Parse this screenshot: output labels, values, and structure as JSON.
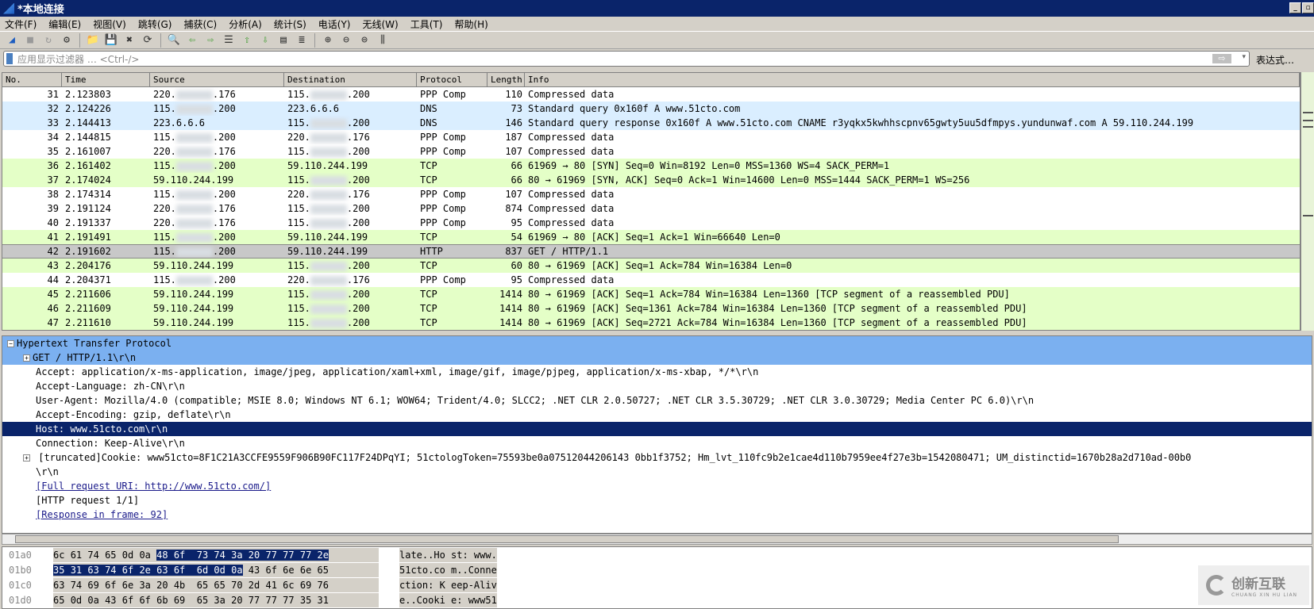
{
  "window": {
    "title": "*本地连接",
    "minimize": "_",
    "restore": "▫"
  },
  "menu": [
    "文件(F)",
    "编辑(E)",
    "视图(V)",
    "跳转(G)",
    "捕获(C)",
    "分析(A)",
    "统计(S)",
    "电话(Y)",
    "无线(W)",
    "工具(T)",
    "帮助(H)"
  ],
  "toolbar_icons": [
    "start-capture",
    "stop-capture",
    "restart-capture",
    "capture-options",
    "|",
    "open-file",
    "save-file",
    "close-file",
    "reload-file",
    "|",
    "find-packet",
    "go-back",
    "go-forward",
    "go-to-packet",
    "go-first",
    "go-last",
    "auto-scroll",
    "colorize",
    "|",
    "zoom-in",
    "zoom-out",
    "zoom-normal",
    "resize-columns"
  ],
  "filter": {
    "placeholder": "应用显示过滤器 … <Ctrl-/>",
    "expression_label": "表达式…",
    "apply": "⇨",
    "dropdown": "▾"
  },
  "columns": [
    "No.",
    "Time",
    "Source",
    "Destination",
    "Protocol",
    "Length",
    "Info"
  ],
  "colors": {
    "dns": "#daeeff",
    "tcp": "#e4ffc7",
    "ppp": "#ffffff",
    "selected": "#c8c8c8"
  },
  "packets": [
    {
      "no": "31",
      "time": "2.123803",
      "src": [
        "220.",
        ".176"
      ],
      "dst": [
        "115.",
        ".200"
      ],
      "proto": "PPP Comp",
      "len": "110",
      "info": "Compressed data",
      "kind": "ppp"
    },
    {
      "no": "32",
      "time": "2.124226",
      "src": [
        "115.",
        ".200"
      ],
      "dst": [
        "223.6.6.6",
        ""
      ],
      "proto": "DNS",
      "len": "73",
      "info": "Standard query 0x160f A www.51cto.com",
      "kind": "dns"
    },
    {
      "no": "33",
      "time": "2.144413",
      "src": [
        "223.6.6.6",
        ""
      ],
      "dst": [
        "115.",
        ".200"
      ],
      "proto": "DNS",
      "len": "146",
      "info": "Standard query response 0x160f A www.51cto.com CNAME r3yqkx5kwhhscpnv65gwty5uu5dfmpys.yundunwaf.com A 59.110.244.199",
      "kind": "dns"
    },
    {
      "no": "34",
      "time": "2.144815",
      "src": [
        "115.",
        ".200"
      ],
      "dst": [
        "220.",
        ".176"
      ],
      "proto": "PPP Comp",
      "len": "187",
      "info": "Compressed data",
      "kind": "ppp"
    },
    {
      "no": "35",
      "time": "2.161007",
      "src": [
        "220.",
        ".176"
      ],
      "dst": [
        "115.",
        ".200"
      ],
      "proto": "PPP Comp",
      "len": "107",
      "info": "Compressed data",
      "kind": "ppp"
    },
    {
      "no": "36",
      "time": "2.161402",
      "src": [
        "115.",
        ".200"
      ],
      "dst": [
        "59.110.244.199",
        ""
      ],
      "proto": "TCP",
      "len": "66",
      "info": "61969 → 80 [SYN] Seq=0 Win=8192 Len=0 MSS=1360 WS=4 SACK_PERM=1",
      "kind": "tcp"
    },
    {
      "no": "37",
      "time": "2.174024",
      "src": [
        "59.110.244.199",
        ""
      ],
      "dst": [
        "115.",
        ".200"
      ],
      "proto": "TCP",
      "len": "66",
      "info": "80 → 61969 [SYN, ACK] Seq=0 Ack=1 Win=14600 Len=0 MSS=1444 SACK_PERM=1 WS=256",
      "kind": "tcp"
    },
    {
      "no": "38",
      "time": "2.174314",
      "src": [
        "115.",
        ".200"
      ],
      "dst": [
        "220.",
        ".176"
      ],
      "proto": "PPP Comp",
      "len": "107",
      "info": "Compressed data",
      "kind": "ppp"
    },
    {
      "no": "39",
      "time": "2.191124",
      "src": [
        "220.",
        ".176"
      ],
      "dst": [
        "115.",
        ".200"
      ],
      "proto": "PPP Comp",
      "len": "874",
      "info": "Compressed data",
      "kind": "ppp"
    },
    {
      "no": "40",
      "time": "2.191337",
      "src": [
        "220.",
        ".176"
      ],
      "dst": [
        "115.",
        ".200"
      ],
      "proto": "PPP Comp",
      "len": "95",
      "info": "Compressed data",
      "kind": "ppp"
    },
    {
      "no": "41",
      "time": "2.191491",
      "src": [
        "115.",
        ".200"
      ],
      "dst": [
        "59.110.244.199",
        ""
      ],
      "proto": "TCP",
      "len": "54",
      "info": "61969 → 80 [ACK] Seq=1 Ack=1 Win=66640 Len=0",
      "kind": "tcp"
    },
    {
      "no": "42",
      "time": "2.191602",
      "src": [
        "115.",
        ".200"
      ],
      "dst": [
        "59.110.244.199",
        ""
      ],
      "proto": "HTTP",
      "len": "837",
      "info": "GET / HTTP/1.1",
      "kind": "selected"
    },
    {
      "no": "43",
      "time": "2.204176",
      "src": [
        "59.110.244.199",
        ""
      ],
      "dst": [
        "115.",
        ".200"
      ],
      "proto": "TCP",
      "len": "60",
      "info": "80 → 61969 [ACK] Seq=1 Ack=784 Win=16384 Len=0",
      "kind": "tcp"
    },
    {
      "no": "44",
      "time": "2.204371",
      "src": [
        "115.",
        ".200"
      ],
      "dst": [
        "220.",
        ".176"
      ],
      "proto": "PPP Comp",
      "len": "95",
      "info": "Compressed data",
      "kind": "ppp"
    },
    {
      "no": "45",
      "time": "2.211606",
      "src": [
        "59.110.244.199",
        ""
      ],
      "dst": [
        "115.",
        ".200"
      ],
      "proto": "TCP",
      "len": "1414",
      "info": "80 → 61969 [ACK] Seq=1 Ack=784 Win=16384 Len=1360 [TCP segment of a reassembled PDU]",
      "kind": "tcp"
    },
    {
      "no": "46",
      "time": "2.211609",
      "src": [
        "59.110.244.199",
        ""
      ],
      "dst": [
        "115.",
        ".200"
      ],
      "proto": "TCP",
      "len": "1414",
      "info": "80 → 61969 [ACK] Seq=1361 Ack=784 Win=16384 Len=1360 [TCP segment of a reassembled PDU]",
      "kind": "tcp"
    },
    {
      "no": "47",
      "time": "2.211610",
      "src": [
        "59.110.244.199",
        ""
      ],
      "dst": [
        "115.",
        ".200"
      ],
      "proto": "TCP",
      "len": "1414",
      "info": "80 → 61969 [ACK] Seq=2721 Ack=784 Win=16384 Len=1360 [TCP segment of a reassembled PDU]",
      "kind": "tcp"
    }
  ],
  "details": [
    {
      "text": "Hypertext Transfer Protocol",
      "indent": 0,
      "box": "−",
      "style": "hl"
    },
    {
      "text": "GET / HTTP/1.1\\r\\n",
      "indent": 1,
      "box": "+",
      "style": "hl"
    },
    {
      "text": "Accept: application/x-ms-application, image/jpeg, application/xaml+xml, image/gif, image/pjpeg, application/x-ms-xbap, */*\\r\\n",
      "indent": 2
    },
    {
      "text": "Accept-Language: zh-CN\\r\\n",
      "indent": 2
    },
    {
      "text": "User-Agent: Mozilla/4.0 (compatible; MSIE 8.0; Windows NT 6.1; WOW64; Trident/4.0; SLCC2; .NET CLR 2.0.50727; .NET CLR 3.5.30729; .NET CLR 3.0.30729; Media Center PC 6.0)\\r\\n",
      "indent": 2
    },
    {
      "text": "Accept-Encoding: gzip, deflate\\r\\n",
      "indent": 2
    },
    {
      "text": "Host: www.51cto.com\\r\\n",
      "indent": 2,
      "style": "sel"
    },
    {
      "text": "Connection: Keep-Alive\\r\\n",
      "indent": 2
    },
    {
      "text": " [truncated]Cookie: www51cto=8F1C21A3CCFE9559F906B90FC117F24DPqYI; 51ctologToken=75593be0a07512044206143 0bb1f3752; Hm_lvt_110fc9b2e1cae4d110b7959ee4f27e3b=1542080471; UM_distinctid=1670b28a2d710ad-00b0",
      "indent": 1,
      "box": "+"
    },
    {
      "text": "\\r\\n",
      "indent": 2
    },
    {
      "text": "[Full request URI: http://www.51cto.com/]",
      "indent": 2,
      "style": "link"
    },
    {
      "text": "[HTTP request 1/1]",
      "indent": 2
    },
    {
      "text": "[Response in frame: 92]",
      "indent": 2,
      "style": "link"
    }
  ],
  "hex": [
    {
      "off": "01a0",
      "bytes": [
        "6c",
        "61",
        "74",
        "65",
        "0d",
        "0a",
        "48",
        "6f",
        "73",
        "74",
        "3a",
        "20",
        "77",
        "77",
        "77",
        "2e"
      ],
      "ascii": "late..Ho st: www.",
      "sel": [
        6,
        16
      ]
    },
    {
      "off": "01b0",
      "bytes": [
        "35",
        "31",
        "63",
        "74",
        "6f",
        "2e",
        "63",
        "6f",
        "6d",
        "0d",
        "0a",
        "43",
        "6f",
        "6e",
        "6e",
        "65"
      ],
      "ascii": "51cto.co m..Conne",
      "sel": [
        0,
        11
      ]
    },
    {
      "off": "01c0",
      "bytes": [
        "63",
        "74",
        "69",
        "6f",
        "6e",
        "3a",
        "20",
        "4b",
        "65",
        "65",
        "70",
        "2d",
        "41",
        "6c",
        "69",
        "76"
      ],
      "ascii": "ction: K eep-Aliv",
      "sel": null
    },
    {
      "off": "01d0",
      "bytes": [
        "65",
        "0d",
        "0a",
        "43",
        "6f",
        "6f",
        "6b",
        "69",
        "65",
        "3a",
        "20",
        "77",
        "77",
        "77",
        "35",
        "31"
      ],
      "ascii": "e..Cooki e: www51",
      "sel": null
    }
  ],
  "watermark": {
    "name": "创新互联",
    "sub": "CHUANG XIN HU LIAN"
  }
}
